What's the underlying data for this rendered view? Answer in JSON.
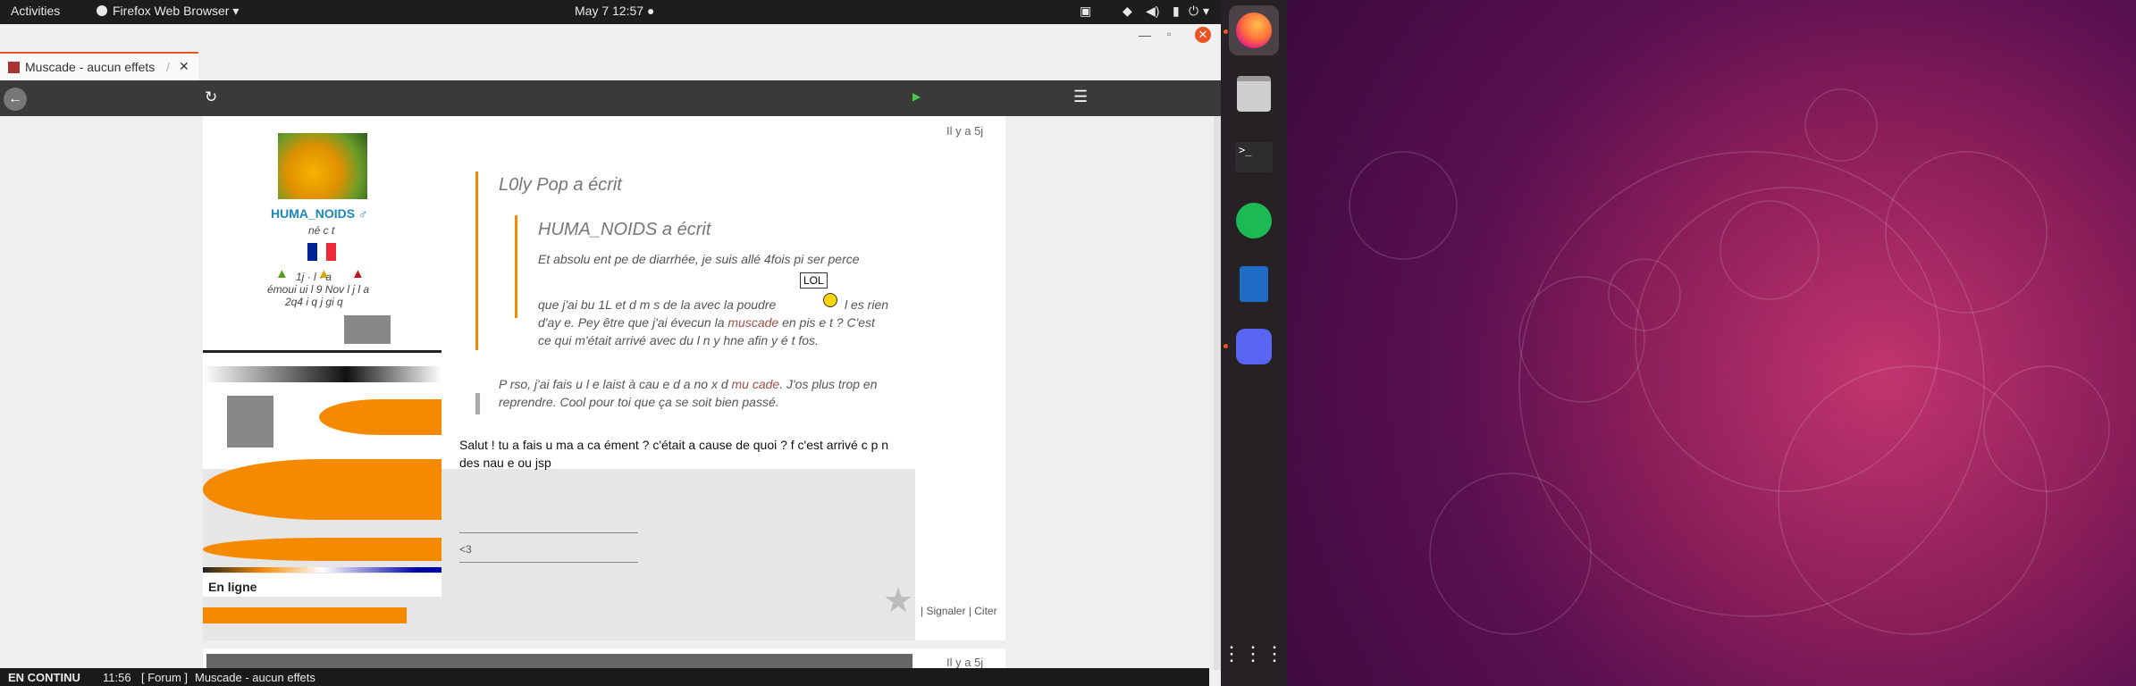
{
  "topbar": {
    "activities": "Activities",
    "app_name": "Firefox Web Browser",
    "datetime": "May 7  12:57"
  },
  "browser": {
    "tab_title": "Muscade - aucun effets",
    "tab_title_fade": "/",
    "statusbar": {
      "mode": "EN CONTINU",
      "time": "11:56",
      "forum": "[ Forum ]",
      "page": "Muscade - aucun effets"
    }
  },
  "post": {
    "time_ago": "Il y a 5j",
    "username": "HUMA_NOIDS",
    "user_meta_1": "né c t",
    "user_stats": "1j  ·  l  ·  a",
    "user_stats_2": "émoui ui  l 9 Nov  l j  l a",
    "user_stats_3": "2q4  i q j  gi q",
    "status_online": "En ligne",
    "quote1_author": "L0ly Pop a écrit",
    "quote2_author": "HUMA_NOIDS a écrit",
    "quote2_line1": "Et absolu  ent pe  de diarrhée, je suis allé 4fois pi ser perce",
    "quote2_line2": "que j'ai bu 1L et d  m s de la  avec la poudre",
    "quote2_line2b": "l  es  rien",
    "quote2_line3a": "d'ay  e. Pey  être que j'ai évecun la ",
    "quote2_link": "muscade",
    "quote2_line3b": " en pis  e t ? C'est",
    "quote2_line4": "ce qui m'était arrivé avec du l  n  y  hne  afin  y é t fos.",
    "lol_badge": "LOL",
    "quote1_line1a": "P  rso, j'ai fais u  l  e laist  à cau  e d  a no x d  ",
    "quote1_link": "mu  cade",
    "quote1_line1b": ". J'os   plus trop en",
    "quote1_line2": "reprendre. Cool pour toi que ça se soit bien passé.",
    "reply_line1": "Salut ! tu a fais u  ma  a  ca  ément ? c'était a cause de quoi ? f  c'est arrivé c  p  n",
    "reply_line2": "des nau  e  ou jsp",
    "signature": "<3",
    "actions": "| Signaler | Citer",
    "next_time": "Il y a 5j"
  },
  "colors": {
    "accent": "#e95420",
    "link": "#1a87b8",
    "quote_bar": "#f58a00"
  },
  "dock": {
    "icons": [
      "firefox-icon",
      "files-icon",
      "terminal-icon",
      "spotify-icon",
      "writer-icon",
      "discord-icon",
      "app-grid-icon"
    ]
  }
}
